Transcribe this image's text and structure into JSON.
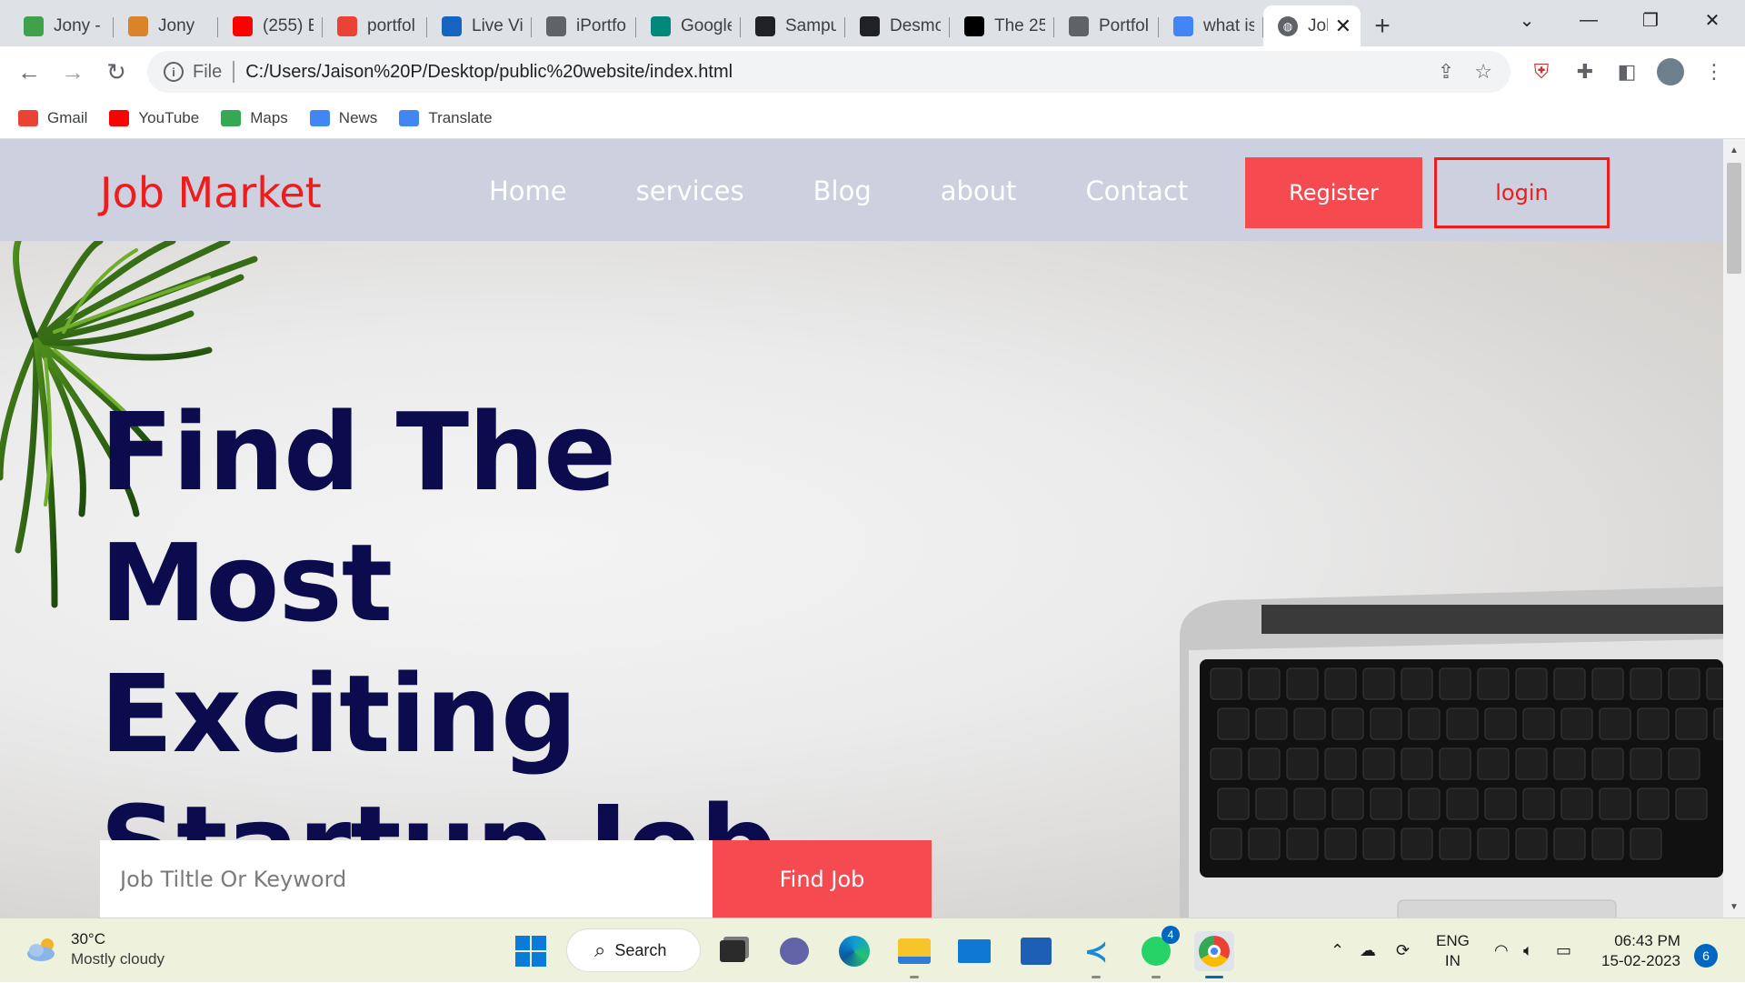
{
  "browser": {
    "tabs": [
      {
        "title": "Jony - I",
        "icon": "leaf-favicon",
        "color": "#3fa24b"
      },
      {
        "title": "Jony",
        "icon": "jony-favicon",
        "color": "#d9842a"
      },
      {
        "title": "(255) E",
        "icon": "youtube-favicon",
        "color": "#ff0000"
      },
      {
        "title": "portfol",
        "icon": "gmail-favicon",
        "color": "#ea4335"
      },
      {
        "title": "Live Vi",
        "icon": "tm-favicon",
        "color": "#1565c0"
      },
      {
        "title": "iPortfo",
        "icon": "globe-favicon",
        "color": "#5f6368"
      },
      {
        "title": "Google",
        "icon": "meet-favicon",
        "color": "#00897b"
      },
      {
        "title": "Sampu",
        "icon": "github-favicon",
        "color": "#202124"
      },
      {
        "title": "Desmo",
        "icon": "desmos-favicon",
        "color": "#202124"
      },
      {
        "title": "The 25",
        "icon": "medium-favicon",
        "color": "#000000"
      },
      {
        "title": "Portfoli",
        "icon": "globe-favicon",
        "color": "#5f6368"
      },
      {
        "title": "what is",
        "icon": "google-favicon",
        "color": "#4285f4"
      }
    ],
    "active_tab": {
      "title": "Job",
      "icon": "globe-favicon"
    },
    "address": {
      "scheme": "File",
      "url": "C:/Users/Jaison%20P/Desktop/public%20website/index.html"
    },
    "bookmarks": [
      {
        "label": "Gmail",
        "icon": "gmail-icon",
        "color": "#ea4335"
      },
      {
        "label": "YouTube",
        "icon": "youtube-icon",
        "color": "#ff0000"
      },
      {
        "label": "Maps",
        "icon": "maps-icon",
        "color": "#34a853"
      },
      {
        "label": "News",
        "icon": "news-icon",
        "color": "#4285f4"
      },
      {
        "label": "Translate",
        "icon": "translate-icon",
        "color": "#4285f4"
      }
    ]
  },
  "site": {
    "logo": "Job Market",
    "nav": [
      "Home",
      "services",
      "Blog",
      "about",
      "Contact"
    ],
    "register_label": "Register",
    "login_label": "login",
    "headline": [
      "Find The Most",
      "Exciting",
      "Startup Job"
    ],
    "search_placeholder": "Job Tiltle Or Keyword",
    "find_label": "Find Job",
    "colors": {
      "accent": "#f44a50",
      "logo": "#ee1c1c",
      "headline": "#0b0b4d",
      "nav_bg": "#cdd0de"
    }
  },
  "taskbar": {
    "weather_temp": "30°C",
    "weather_cond": "Mostly cloudy",
    "search_label": "Search",
    "whatsapp_badge": "4",
    "lang_top": "ENG",
    "lang_bottom": "IN",
    "time": "06:43 PM",
    "date": "15-02-2023",
    "notification_count": "6"
  }
}
